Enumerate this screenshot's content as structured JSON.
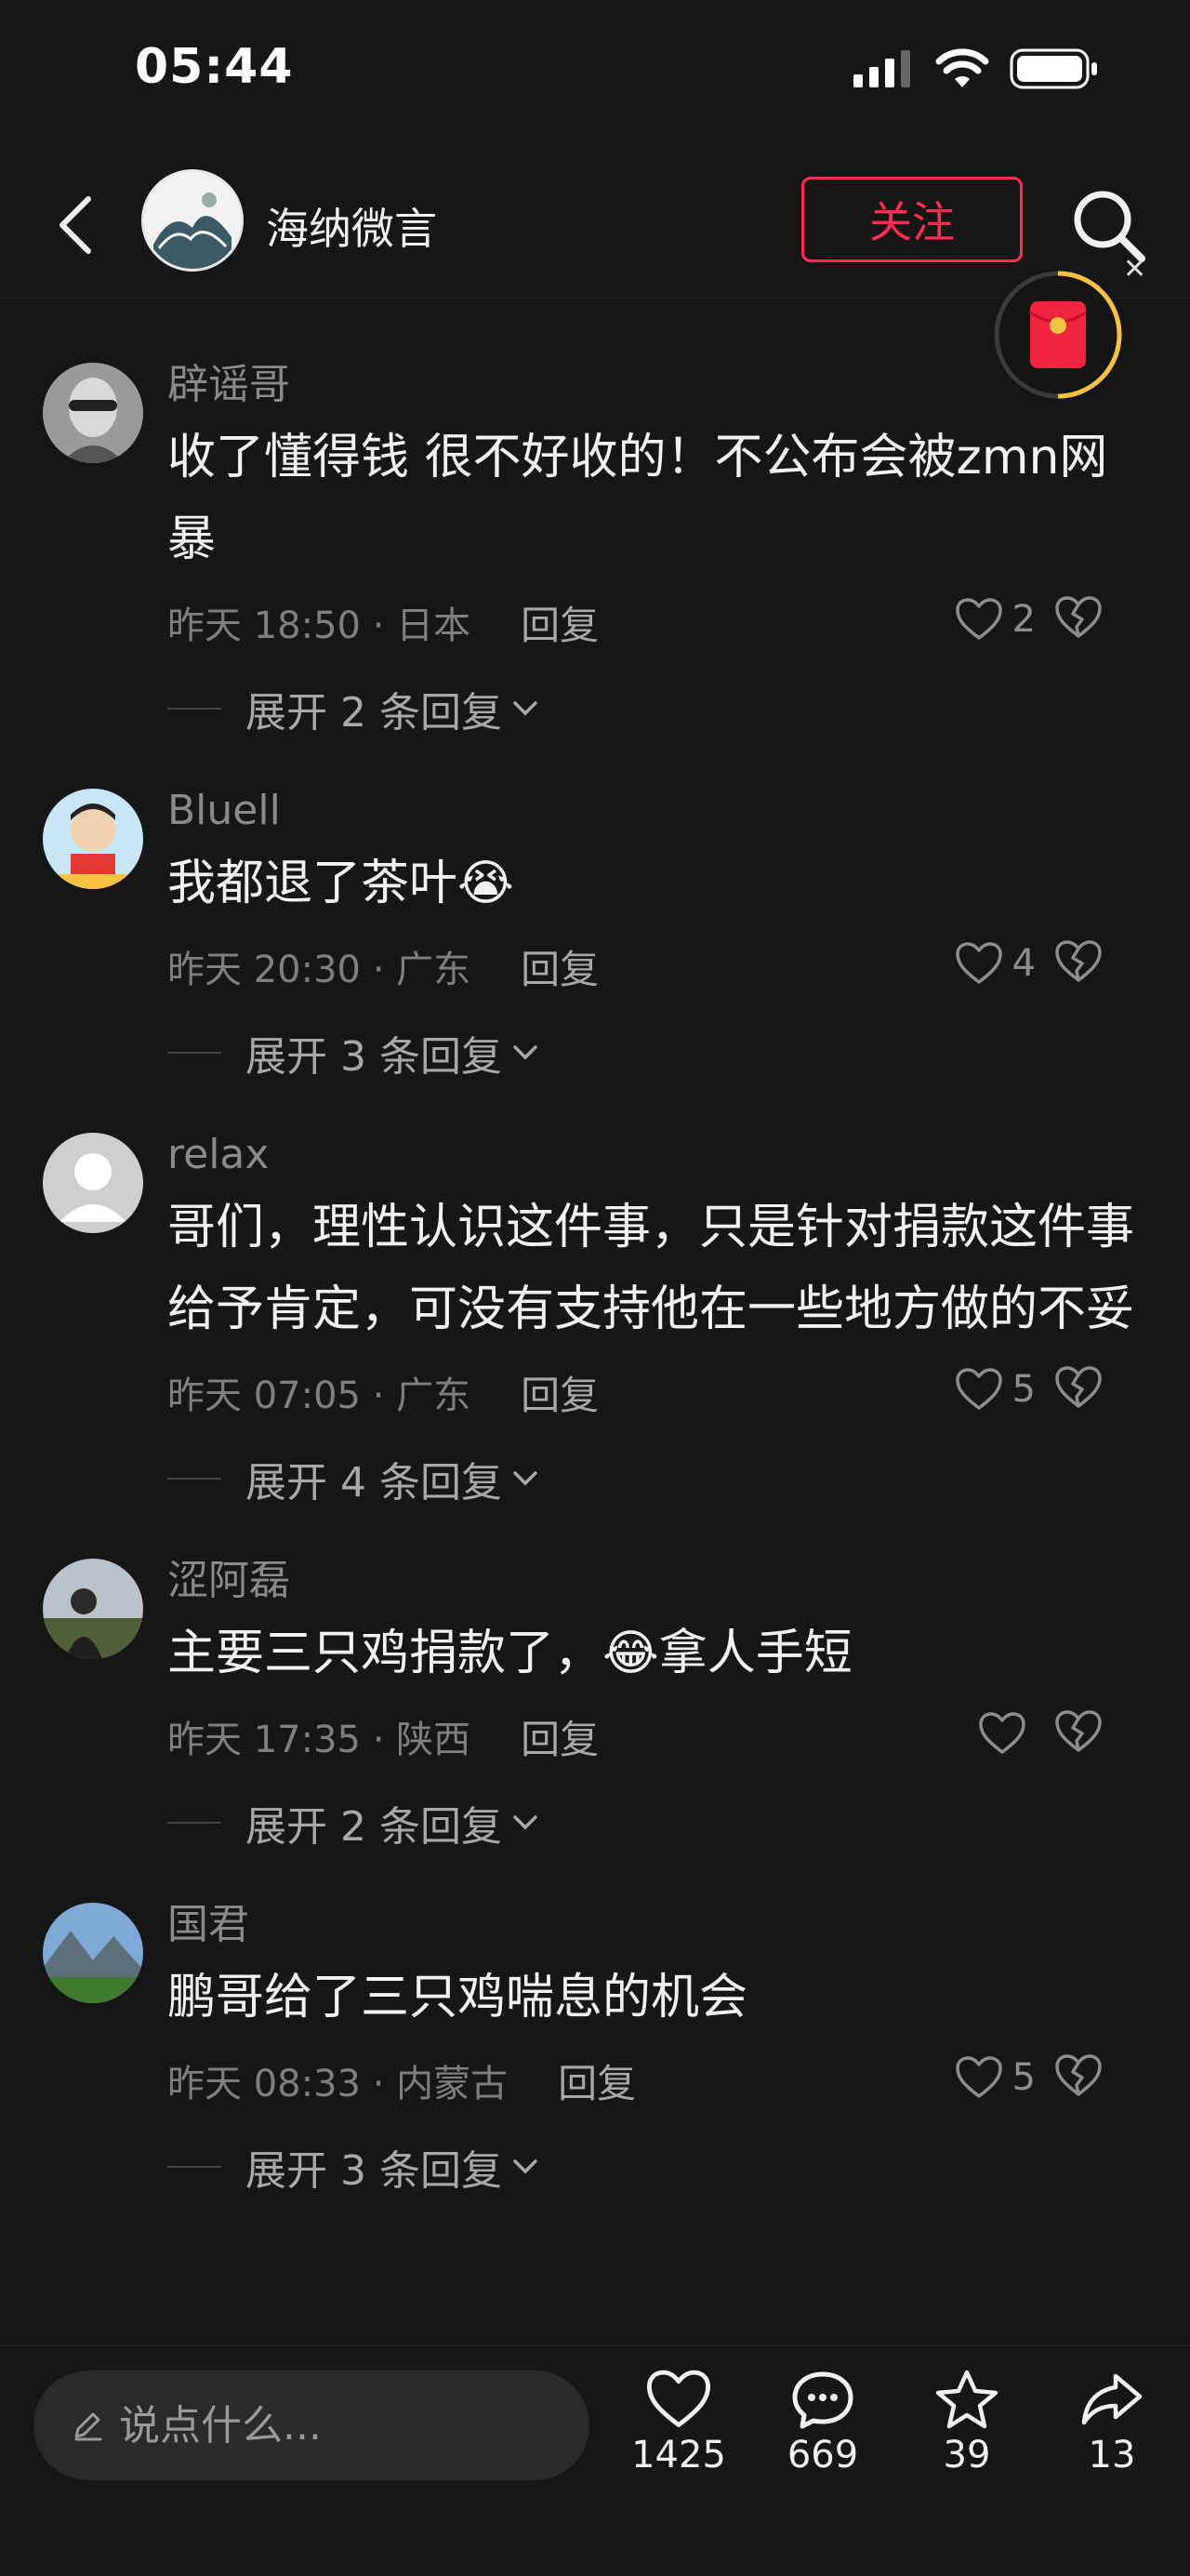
{
  "status_bar": {
    "time": "05:44"
  },
  "header": {
    "channel_name": "海纳微言",
    "follow_label": "关注"
  },
  "comments": [
    {
      "user": "辟谣哥",
      "text": "收了懂得钱 很不好收的！不公布会被zmn网暴",
      "time": "昨天 18:50 · 日本",
      "reply": "回复",
      "likes": "2",
      "expand": "展开 2 条回复"
    },
    {
      "user": "Bluell",
      "text": "我都退了茶叶😭",
      "time": "昨天 20:30 · 广东",
      "reply": "回复",
      "likes": "4",
      "expand": "展开 3 条回复"
    },
    {
      "user": "relax",
      "text": "哥们，理性认识这件事，只是针对捐款这件事给予肯定，可没有支持他在一些地方做的不妥",
      "time": "昨天 07:05 · 广东",
      "reply": "回复",
      "likes": "5",
      "expand": "展开 4 条回复"
    },
    {
      "user": "涩阿磊",
      "text": "主要三只鸡捐款了，😂拿人手短",
      "time": "昨天 17:35 · 陕西",
      "reply": "回复",
      "likes": "",
      "expand": "展开 2 条回复"
    },
    {
      "user": "国君",
      "text": "鹏哥给了三只鸡喘息的机会",
      "time": "昨天 08:33 · 内蒙古",
      "reply": "回复",
      "likes": "5",
      "expand": "展开 3 条回复"
    }
  ],
  "bottom_bar": {
    "input_placeholder": "说点什么...",
    "like_count": "1425",
    "comment_count": "669",
    "favorite_count": "39",
    "share_count": "13"
  },
  "colors": {
    "accent": "#fe2c55",
    "background": "#161616"
  },
  "icons": [
    "back-icon",
    "search-icon",
    "red-packet-icon",
    "heart-icon",
    "broken-heart-icon",
    "chevron-down-icon",
    "pen-icon",
    "comment-icon",
    "star-icon",
    "share-icon"
  ]
}
